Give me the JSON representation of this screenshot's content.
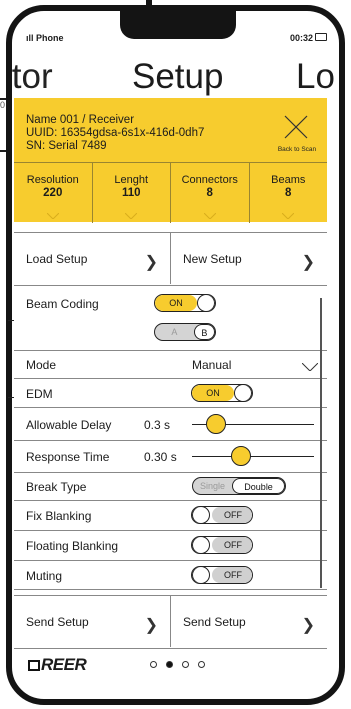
{
  "status_bar": {
    "carrier": "Phone",
    "time": "00:32"
  },
  "nav": {
    "prev_title": "itor",
    "title": "Setup",
    "next_title": "Lo"
  },
  "device": {
    "name_line": "Name 001 / Receiver",
    "uuid_line": "UUID: 16354gdsa-6s1x-416d-0dh7",
    "sn_line": "SN: Serial 7489",
    "back_label": "Back to Scan",
    "stats": [
      {
        "label": "Resolution",
        "value": "220"
      },
      {
        "label": "Lenght",
        "value": "110"
      },
      {
        "label": "Connectors",
        "value": "8"
      },
      {
        "label": "Beams",
        "value": "8"
      }
    ]
  },
  "actions_top": {
    "load_label": "Load Setup",
    "new_label": "New Setup"
  },
  "settings": {
    "beam_coding": {
      "label": "Beam Coding",
      "toggle": "ON",
      "options": [
        "A",
        "B"
      ],
      "selected": "B"
    },
    "mode": {
      "label": "Mode",
      "value": "Manual"
    },
    "edm": {
      "label": "EDM",
      "toggle": "ON"
    },
    "allowable_delay": {
      "label": "Allowable Delay",
      "value": "0.3 s",
      "level": 0.14
    },
    "response_time": {
      "label": "Response Time",
      "value": "0.30 s",
      "level": 0.38
    },
    "break_type": {
      "label": "Break Type",
      "options": [
        "Single",
        "Double"
      ],
      "selected": "Double"
    },
    "fix_blanking": {
      "label": "Fix Blanking",
      "toggle": "OFF"
    },
    "floating_blanking": {
      "label": "Floating Blanking",
      "toggle": "OFF"
    },
    "muting": {
      "label": "Muting",
      "toggle": "OFF"
    }
  },
  "actions_bottom": {
    "left_label": "Send Setup",
    "right_label": "Send Setup"
  },
  "footer": {
    "logo_text": "REER",
    "pages": 4,
    "active_page": 1
  },
  "colors": {
    "accent": "#f7cc2e",
    "frame": "#141414"
  }
}
